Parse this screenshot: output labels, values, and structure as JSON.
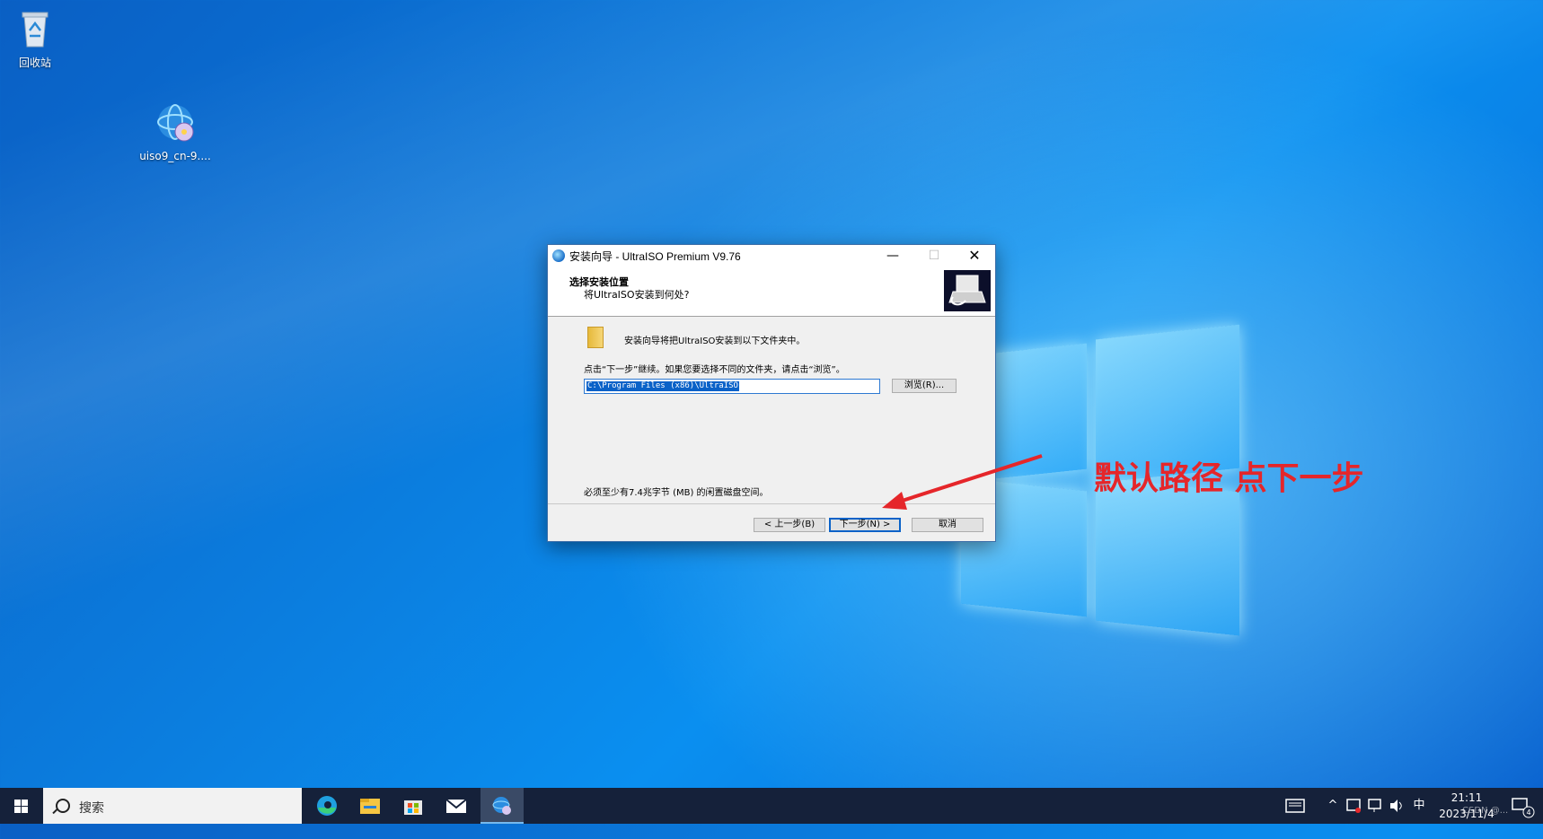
{
  "desktop": {
    "icons": [
      {
        "label": "回收站",
        "icon": "recycle-bin-icon"
      },
      {
        "label": "uiso9_cn-9....",
        "icon": "ultraiso-disc-icon"
      }
    ]
  },
  "dialog": {
    "title": "安装向导 - UltraISO Premium V9.76",
    "header_title": "选择安装位置",
    "header_subtitle": "将UltraISO安装到何处?",
    "install_line": "安装向导将把UltraISO安装到以下文件夹中。",
    "instruction": "点击“下一步”继续。如果您要选择不同的文件夹，请点击“浏览”。",
    "path_value": "C:\\Program Files (x86)\\UltraISO",
    "browse_label": "浏览(R)...",
    "space_required": "必须至少有7.4兆字节 (MB) 的闲置磁盘空间。",
    "back_label": "< 上一步(B)",
    "next_label": "下一步(N) >",
    "cancel_label": "取消",
    "minimize": "—",
    "maximize": "☐",
    "close": "✕"
  },
  "annotation": {
    "text": "默认路径 点下一步",
    "color": "#e5262a"
  },
  "taskbar": {
    "search_placeholder": "搜索",
    "apps": [
      "edge-icon",
      "file-explorer-icon",
      "store-icon",
      "mail-icon",
      "ultraiso-icon"
    ],
    "tray": {
      "ime": "中",
      "time": "21:11",
      "date": "2023/11/4",
      "notification_count": "4"
    },
    "watermark": "CSDN @..."
  },
  "colors": {
    "accent": "#0a62c8",
    "taskbar": "#15213a"
  }
}
